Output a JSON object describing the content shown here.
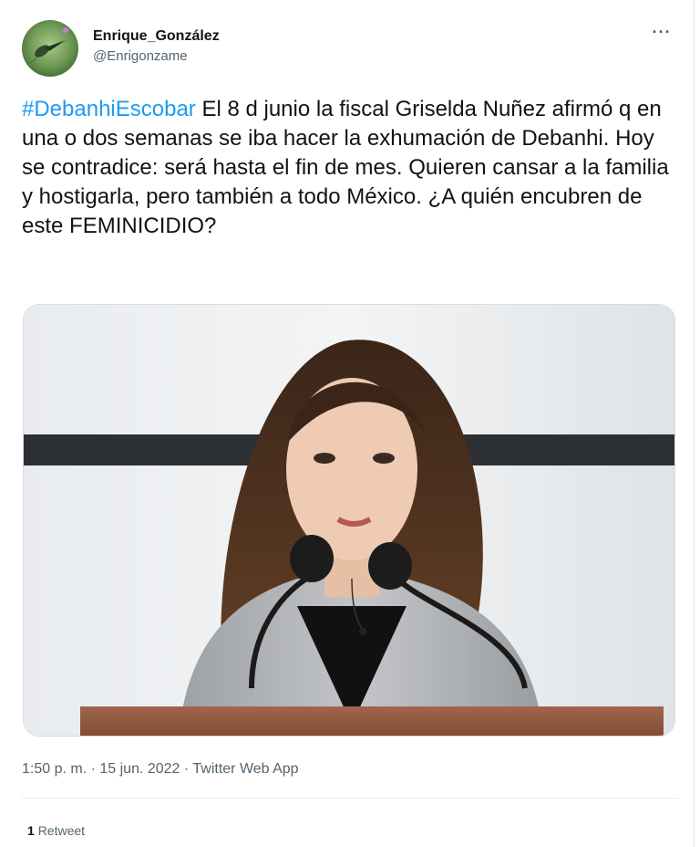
{
  "tweet": {
    "author": {
      "display_name": "Enrique_González",
      "handle": "@Enrigonzame",
      "avatar_icon": "hummingbird-avatar"
    },
    "more_label": "···",
    "hashtag": "#DebanhiEscobar",
    "text": " El 8 d junio la fiscal Griselda Nuñez afirmó q en una o dos semanas se iba hacer la exhumación de Debanhi. Hoy se contradice: será hasta el fin de mes. Quieren cansar a la familia y hostigarla, pero también a todo México. ¿A quién encubren de este FEMINICIDIO?",
    "meta": "1:50 p. m. · 15 jun. 2022 · Twitter Web App",
    "retweet_count": "1",
    "retweet_label": "Retweet",
    "colors": {
      "link": "#1d9bf0",
      "text": "#0f1419",
      "muted": "#536471"
    }
  }
}
